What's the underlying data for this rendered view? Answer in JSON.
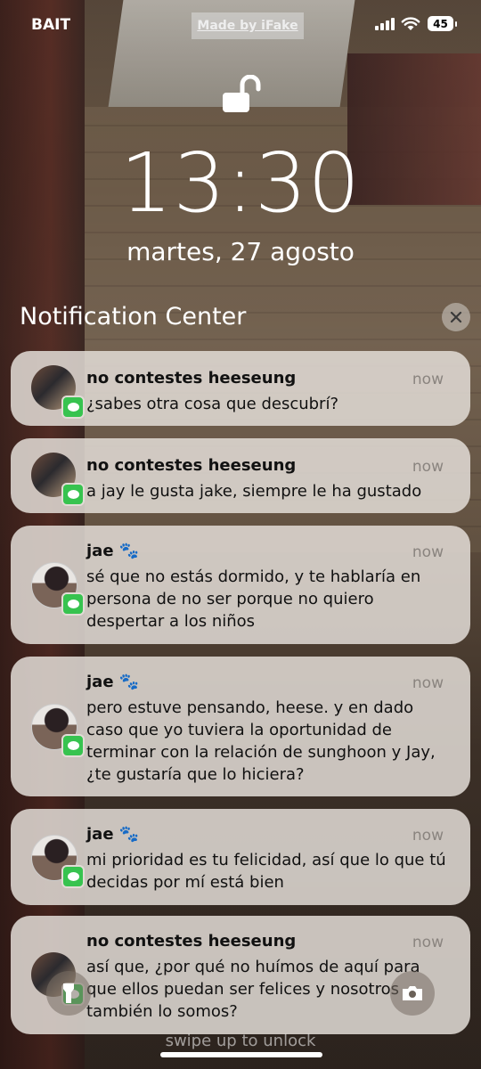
{
  "status": {
    "carrier": "BAIT",
    "watermark": "Made by iFake",
    "battery": "45"
  },
  "lockscreen": {
    "time": "13:30",
    "date": "martes, 27 agosto",
    "swipe_hint": "swipe up to unlock"
  },
  "notification_center": {
    "title": "Notification Center"
  },
  "notifications": [
    {
      "sender": "no contestes heeseung",
      "time": "now",
      "body": "¿sabes otra cosa que descubrí?",
      "avatar": "group-photo"
    },
    {
      "sender": "no contestes heeseung",
      "time": "now",
      "body": "a jay le gusta jake, siempre le ha gustado",
      "avatar": "group-photo"
    },
    {
      "sender": "jae 🐾",
      "time": "now",
      "body": "sé que no estás dormido, y te hablaría en persona de no ser porque no quiero despertar a los niños",
      "avatar": "person-photo"
    },
    {
      "sender": "jae 🐾",
      "time": "now",
      "body": "pero estuve pensando, heese. y en dado caso que yo tuviera la oportunidad de terminar con la relación de sunghoon y Jay, ¿te gustaría que lo hiciera?",
      "avatar": "person-photo"
    },
    {
      "sender": "jae 🐾",
      "time": "now",
      "body": "mi prioridad es tu felicidad, así que lo que tú decidas por mí está bien",
      "avatar": "person-photo"
    },
    {
      "sender": "no contestes heeseung",
      "time": "now",
      "body": "así que, ¿por qué no huímos de aquí para que ellos puedan ser felices y nosotros también lo somos?",
      "avatar": "group-photo"
    }
  ],
  "colors": {
    "message_green": "#37c34f",
    "card_bg": "#e2dcd6"
  }
}
